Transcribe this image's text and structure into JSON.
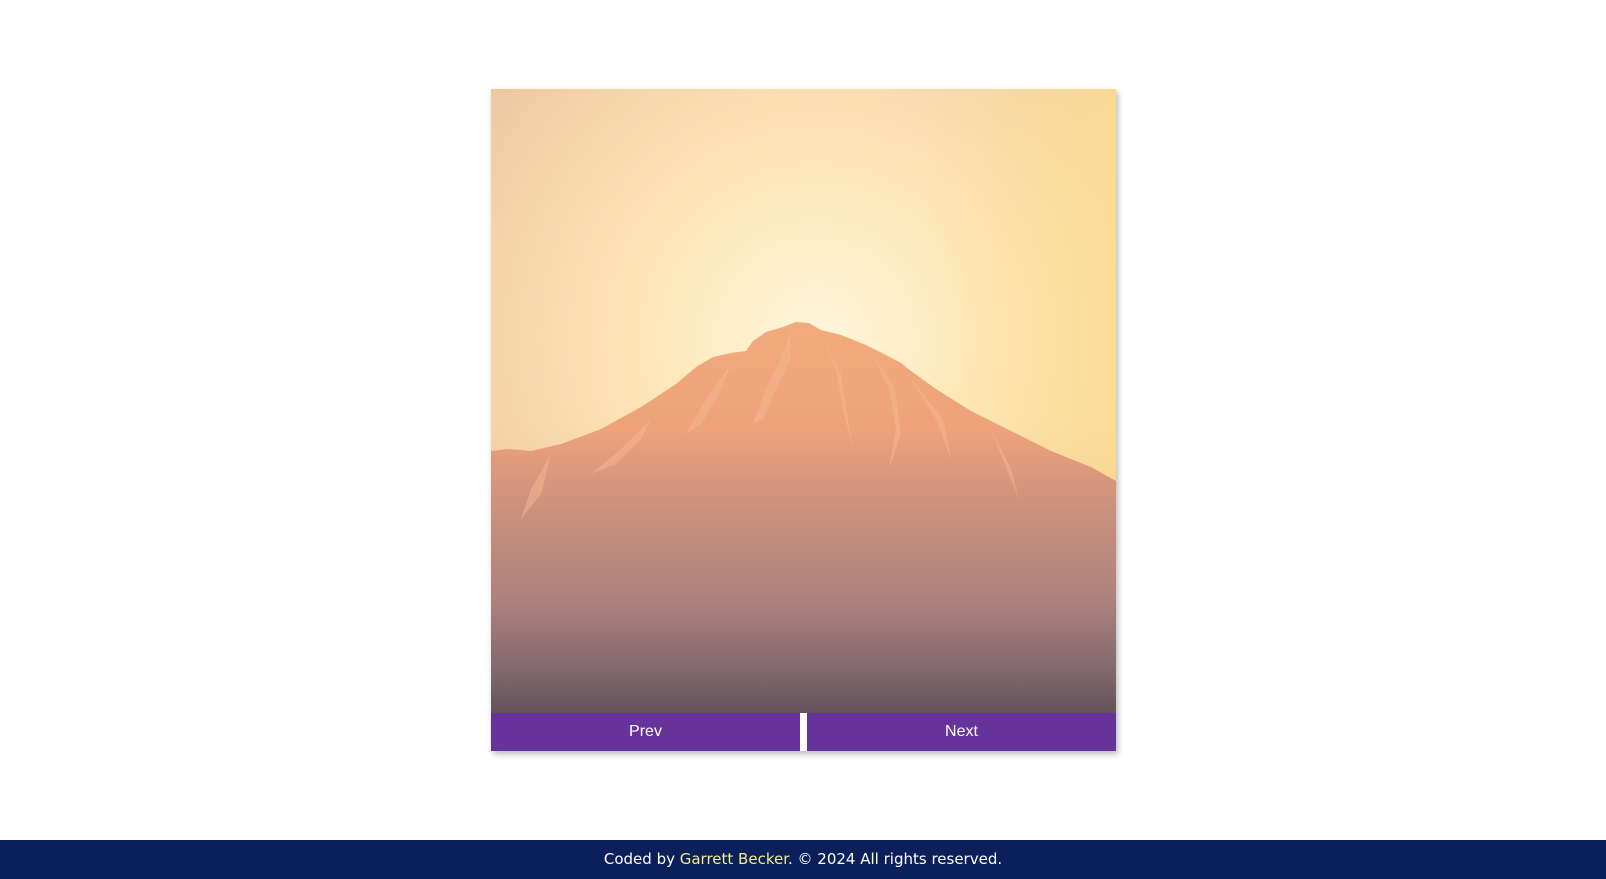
{
  "slideshow": {
    "image": {
      "subject": "mountain-at-sunset-photo",
      "colors": {
        "sky_top": "#ecc9a6",
        "sky_glow": "#fff1cc",
        "sky_right": "#fde19a",
        "mountain_light": "#f1a97a",
        "mountain_mid": "#b17e7a",
        "mountain_base": "#574a52"
      }
    },
    "prev_label": "Prev",
    "next_label": "Next",
    "button_color": "#66339a"
  },
  "footer": {
    "prefix": "Coded by ",
    "author_link": "Garrett Becker",
    "suffix": ". © 2024 All rights reserved.",
    "background": "#0b1f5b",
    "link_color": "#f3eb8f"
  }
}
